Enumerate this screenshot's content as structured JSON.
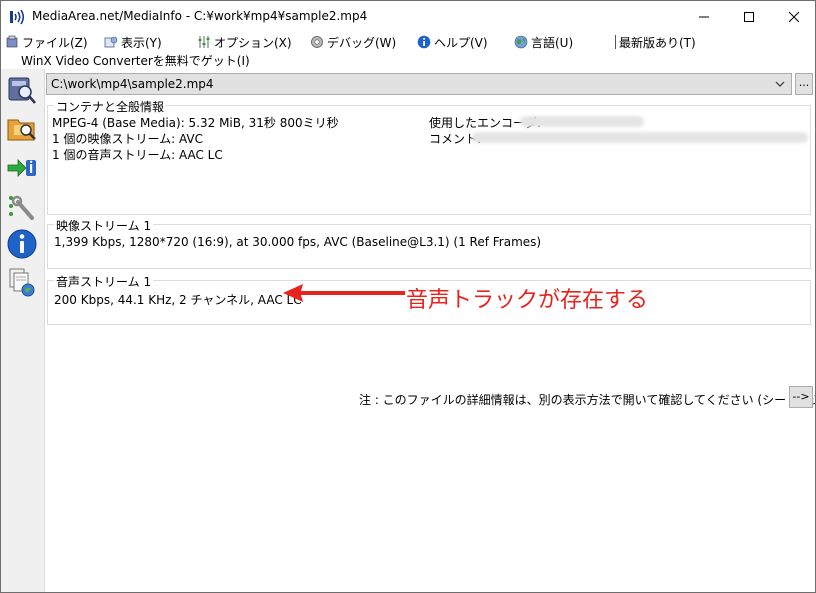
{
  "window": {
    "title": "MediaArea.net/MediaInfo - C:¥work¥mp4¥sample2.mp4"
  },
  "menu": [
    {
      "label": "ファイル(Z)",
      "icon": "file-icon"
    },
    {
      "label": "表示(Y)",
      "icon": "view-icon"
    },
    {
      "label": "オプション(X)",
      "icon": "options-icon"
    },
    {
      "label": "デバッグ(W)",
      "icon": "debug-icon"
    },
    {
      "label": "ヘルプ(V)",
      "icon": "help-icon"
    },
    {
      "label": "言語(U)",
      "icon": "globe-icon"
    },
    {
      "label": "最新版あり(T)",
      "icon": "separator"
    }
  ],
  "sponsor": "WinX Video Converterを無料でゲット(I)",
  "file": {
    "path": "C:\\work\\mp4\\sample2.mp4",
    "browse_label": "..."
  },
  "general": {
    "title": "コンテナと全般情報",
    "lines": [
      "MPEG-4 (Base Media): 5.32 MiB, 31秒 800ミリ秒",
      "1 個の映像ストリーム: AVC",
      "1 個の音声ストリーム: AAC LC"
    ],
    "encoder_label": "使用したエンコーダ:",
    "comment_label": "コメント:"
  },
  "video": {
    "title": "映像ストリーム 1",
    "line": "1,399 Kbps, 1280*720 (16:9), at 30.000 fps, AVC (Baseline@L3.1) (1 Ref Frames)"
  },
  "audio": {
    "title": "音声ストリーム 1",
    "line": "200 Kbps, 44.1 KHz, 2 チャンネル, AAC LC"
  },
  "annotation": "音声トラックが存在する",
  "note": "注 : このファイルの詳細情報は、別の表示方法で開いて確認してください (シート、ツリーなど)",
  "note_button": "-->",
  "colors": {
    "annotation": "#e8231e",
    "toolbar_bg": "#f0f0f0"
  }
}
